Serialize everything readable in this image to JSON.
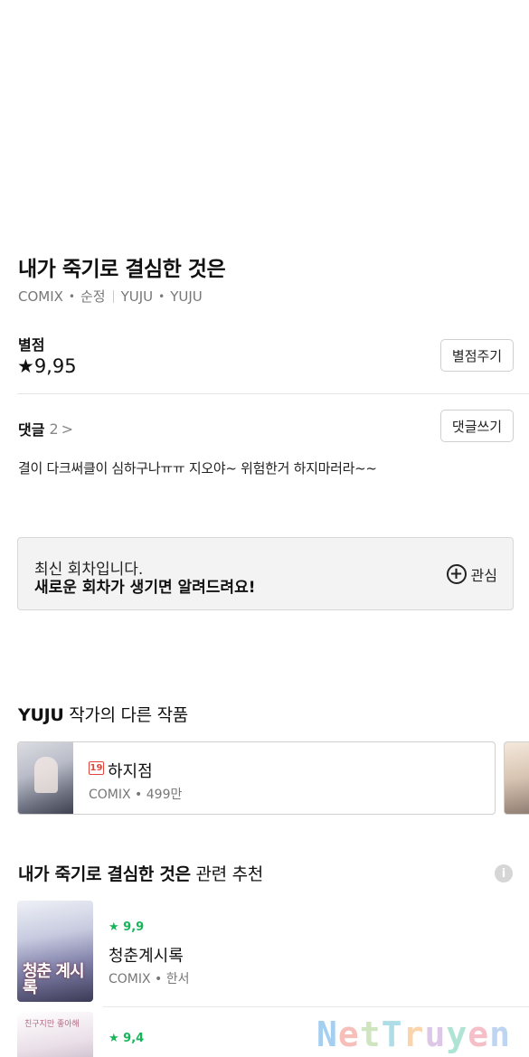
{
  "work": {
    "title": "내가 죽기로 결심한 것은",
    "publisher": "COMIX",
    "genre": "순정",
    "writer": "YUJU",
    "artist": "YUJU"
  },
  "rating": {
    "label": "별점",
    "value": "★9,95",
    "button": "별점주기"
  },
  "comments": {
    "label": "댓글",
    "count": "2",
    "chevron": ">",
    "button": "댓글쓰기",
    "top_comment": "결이 다크써클이 심하구나ㅠㅠ 지오야~ 위험한거 하지마러라~~"
  },
  "notice": {
    "line1": "최신 회차입니다.",
    "line2": "새로운 회차가 생기면 알려드려요!",
    "favorite_icon": "⊕",
    "favorite_label": "관심"
  },
  "other_works": {
    "author": "YUJU",
    "heading_rest": " 작가의 다른 작품",
    "items": [
      {
        "badge": "19",
        "title": "하지점",
        "meta": "COMIX • 499만"
      }
    ]
  },
  "recommend": {
    "heading_bold": "내가 죽기로 결심한 것은",
    "heading_rest": " 관련 추천",
    "info_icon": "i",
    "items": [
      {
        "stars": "★ 9,9",
        "title": "청춘계시록",
        "meta": "COMIX • 한서",
        "cover_text": "청춘 계시록"
      },
      {
        "stars": "★ 9,4",
        "title": "",
        "meta": "",
        "cover_text": "친구지만 좋아해"
      }
    ]
  },
  "watermark": [
    "N",
    "e",
    "t",
    "T",
    "r",
    "u",
    "y",
    "e",
    "n"
  ]
}
